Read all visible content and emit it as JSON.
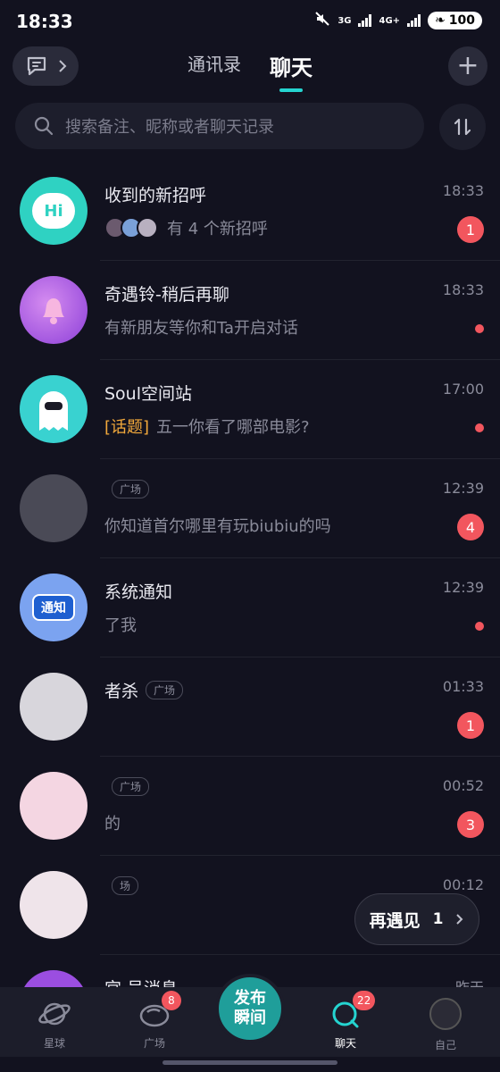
{
  "status": {
    "time": "18:33",
    "net1": "3G",
    "net2": "4G+",
    "battery": "100"
  },
  "header": {
    "tabs": [
      {
        "label": "通讯录"
      },
      {
        "label": "聊天"
      }
    ]
  },
  "search": {
    "placeholder": "搜索备注、昵称或者聊天记录"
  },
  "chats": [
    {
      "name": "收到的新招呼",
      "time": "18:33",
      "message": "有 4 个新招呼",
      "badge": "1"
    },
    {
      "name": "奇遇铃-稍后再聊",
      "time": "18:33",
      "message": "有新朋友等你和Ta开启对话"
    },
    {
      "name": "Soul空间站",
      "time": "17:00",
      "topic_tag": "[话题]",
      "message": "五一你看了哪部电影?"
    },
    {
      "name": "",
      "tag": "广场",
      "time": "12:39",
      "message": "你知道首尔哪里有玩biubiu的吗",
      "badge": "4"
    },
    {
      "name": "系统通知",
      "time": "12:39",
      "message": "了我",
      "avatar_text": "通知"
    },
    {
      "name": "者杀",
      "tag": "广场",
      "time": "01:33",
      "message": "",
      "badge": "1"
    },
    {
      "name": "",
      "tag": "广场",
      "time": "00:52",
      "message": "的",
      "badge": "3"
    },
    {
      "name": "",
      "tag": "场",
      "time": "00:12",
      "message": ""
    },
    {
      "name": "宫 号消息",
      "time": "昨天",
      "message": ""
    }
  ],
  "rematch": {
    "label": "再遇见",
    "count": "1"
  },
  "bottom_nav": {
    "items": [
      {
        "label": "星球"
      },
      {
        "label": "广场",
        "badge": "8"
      },
      {
        "label": "聊天",
        "badge": "22"
      },
      {
        "label": "自己"
      }
    ],
    "publish_line1": "发布",
    "publish_line2": "瞬间"
  },
  "colors": {
    "accent": "#25d4d0",
    "badge": "#f2565e",
    "topic": "#f3a93b",
    "background": "#12121f"
  }
}
